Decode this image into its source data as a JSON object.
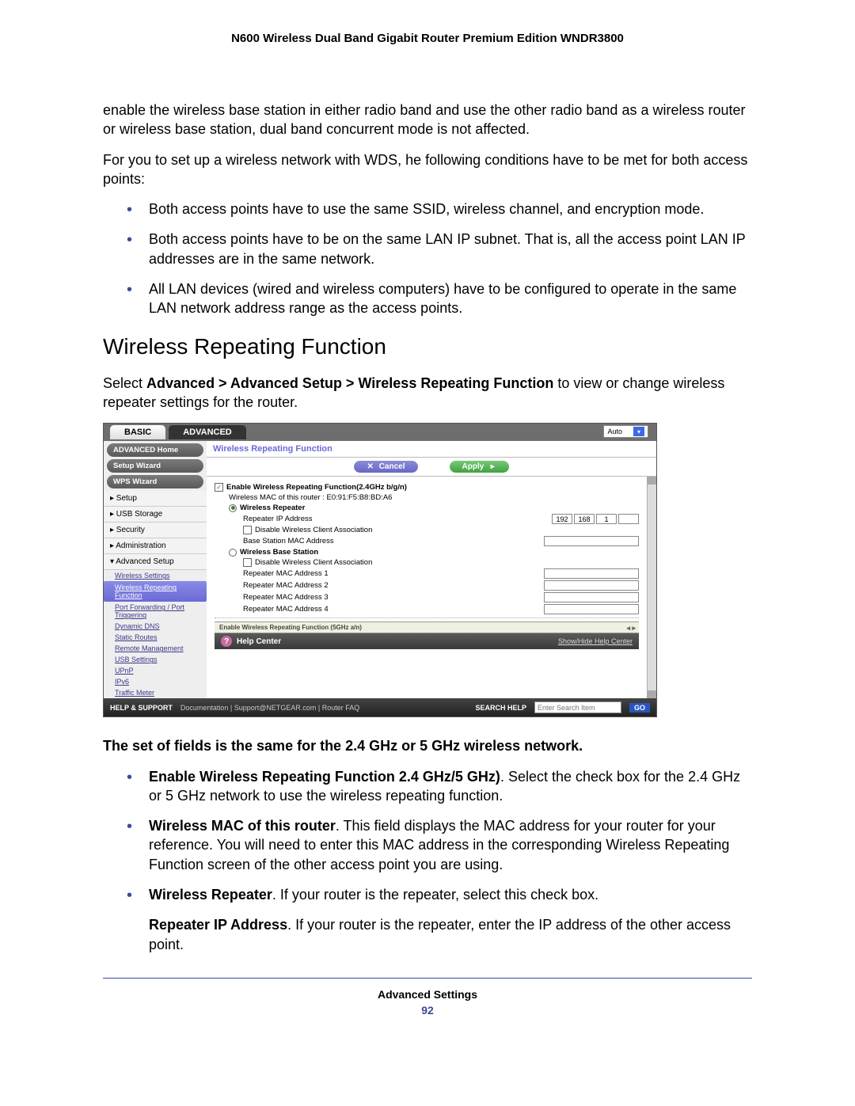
{
  "header": {
    "title": "N600 Wireless Dual Band Gigabit Router Premium Edition WNDR3800"
  },
  "intro": {
    "p1": "enable the wireless base station in either radio band and use the other radio band as a wireless router or wireless base station, dual band concurrent mode is not affected.",
    "p2": "For you to set up a wireless network with WDS,  he following conditions have to be met for both access points:",
    "bullets": [
      "Both access points have to use the same SSID, wireless channel, and encryption mode.",
      "Both access points have to be on the same LAN IP subnet. That is, all the access point LAN IP addresses are in the same network.",
      "All LAN devices (wired and wireless computers) have to be configured to operate in the same LAN network address range as the access points."
    ]
  },
  "section": {
    "heading": "Wireless Repeating Function",
    "desc_pre": "Select ",
    "desc_bold": "Advanced > Advanced Setup > Wireless Repeating Function",
    "desc_post": " to view or change wireless repeater settings for the router."
  },
  "screenshot": {
    "tabs": {
      "basic": "BASIC",
      "advanced": "ADVANCED",
      "auto": "Auto"
    },
    "sidebar": {
      "advanced_home": "ADVANCED Home",
      "setup_wizard": "Setup Wizard",
      "wps_wizard": "WPS Wizard",
      "items": [
        "▸ Setup",
        "▸ USB Storage",
        "▸ Security",
        "▸ Administration",
        "▾ Advanced Setup"
      ],
      "subs": [
        "Wireless Settings",
        "Wireless Repeating Function",
        "Port Forwarding / Port Triggering",
        "Dynamic DNS",
        "Static Routes",
        "Remote Management",
        "USB Settings",
        "UPnP",
        "IPv6",
        "Traffic Meter"
      ]
    },
    "panel": {
      "title": "Wireless Repeating Function",
      "cancel": "Cancel",
      "apply": "Apply",
      "enable_label": "Enable Wireless Repeating Function(2.4GHz b/g/n)",
      "mac_line": "Wireless MAC of this router : E0:91:F5:B8:BD:A6",
      "repeater": "Wireless Repeater",
      "repeater_ip": "Repeater IP Address",
      "ip_values": [
        "192",
        "168",
        "1",
        ""
      ],
      "disable_assoc": "Disable Wireless Client Association",
      "base_mac": "Base Station MAC Address",
      "base_station": "Wireless Base Station",
      "disable_assoc2": "Disable Wireless Client Association",
      "m1": "Repeater MAC Address 1",
      "m2": "Repeater MAC Address 2",
      "m3": "Repeater MAC Address 3",
      "m4": "Repeater MAC Address 4",
      "cutoff": "Enable Wireless Repeating Function (5GHz a/n)",
      "help_center": "Help Center",
      "showhide": "Show/Hide Help Center"
    },
    "footer": {
      "help_support": "HELP & SUPPORT",
      "links": "Documentation | Support@NETGEAR.com | Router FAQ",
      "search_label": "SEARCH HELP",
      "search_placeholder": "Enter Search Item",
      "go": "GO"
    }
  },
  "post": {
    "line1": "The set of fields is the same for the 2.4 GHz or 5 GHz wireless network.",
    "bullets": [
      {
        "b": "Enable Wireless Repeating Function 2.4 GHz/5 GHz)",
        "t": ". Select the check box for the 2.4 GHz or 5 GHz network to use the wireless repeating function."
      },
      {
        "b": "Wireless MAC of this router",
        "t": ". This field displays the MAC address for your router for your reference. You will need to enter this MAC address in the corresponding Wireless Repeating Function screen of the other access point you are using."
      },
      {
        "b": "Wireless Repeater",
        "t": ". If your router is the repeater, select this check box."
      }
    ],
    "sub": {
      "b": "Repeater IP Address",
      "t": ". If your router is the repeater, enter the IP address of the other access point."
    }
  },
  "footer": {
    "label": "Advanced Settings",
    "page": "92"
  }
}
